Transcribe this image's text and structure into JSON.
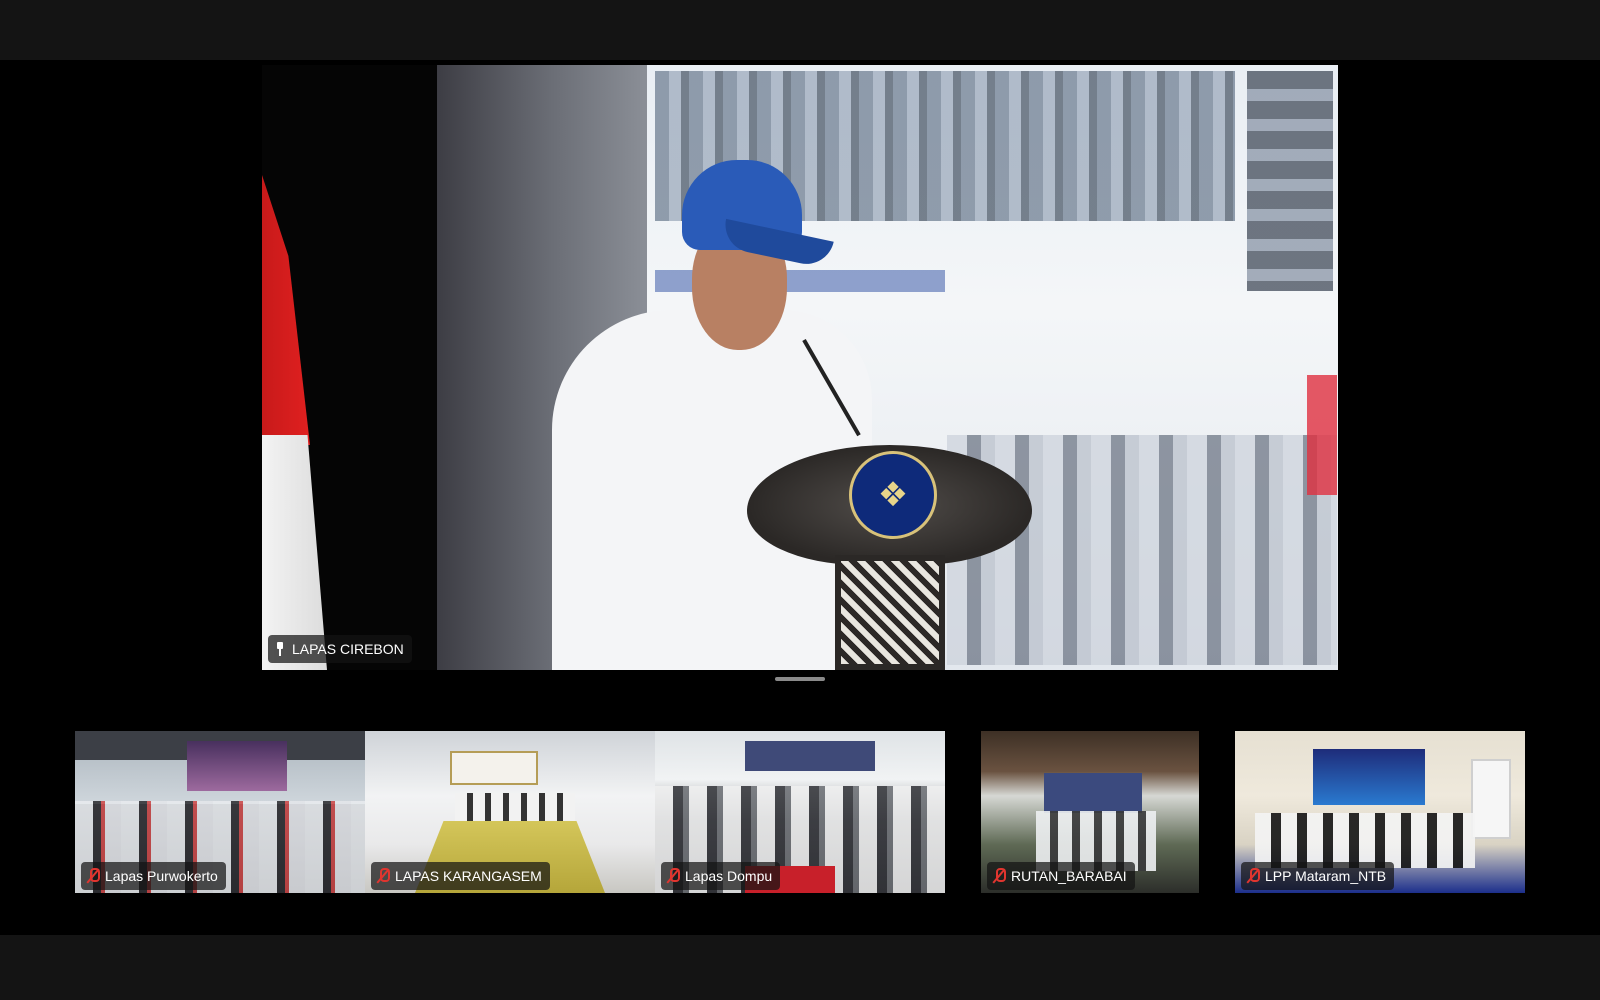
{
  "main_video": {
    "participant_name": "LAPAS CIREBON",
    "pin_icon": "pin-icon"
  },
  "thumbnails": [
    {
      "name": "Lapas Purwokerto",
      "mic_icon": "mic-off-icon"
    },
    {
      "name": "LAPAS KARANGASEM",
      "mic_icon": "mic-off-icon"
    },
    {
      "name": "Lapas Dompu",
      "mic_icon": "mic-off-icon"
    },
    {
      "name": "RUTAN_BARABAI",
      "mic_icon": "mic-off-icon"
    },
    {
      "name": "LPP Mataram_NTB",
      "mic_icon": "mic-off-icon"
    }
  ],
  "colors": {
    "background": "#000000",
    "bars": "#141414",
    "muted_icon": "#e0352f",
    "tag_background": "rgba(20,20,20,0.72)"
  }
}
